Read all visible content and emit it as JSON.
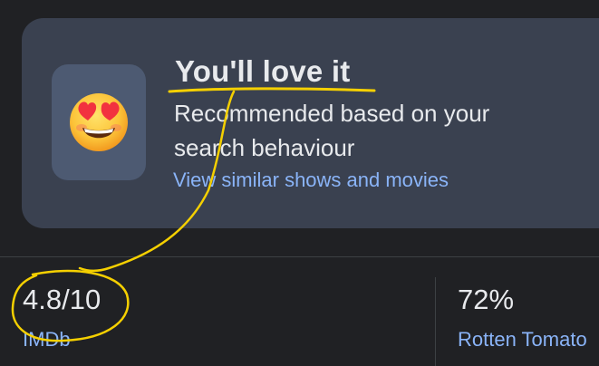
{
  "recommendation": {
    "emoji": "heart-eyes-face-emoji",
    "title": "You'll love it",
    "subtitle": "Recommended based on your search behaviour",
    "link": "View similar shows and movies"
  },
  "ratings": [
    {
      "score": "4.8/10",
      "source": "IMDb"
    },
    {
      "score": "72%",
      "source": "Rotten Tomato"
    }
  ],
  "colors": {
    "background": "#202124",
    "card": "#3a4150",
    "emoji_tile": "#4d5a72",
    "link": "#8ab4f8",
    "annotation": "#f5d000"
  }
}
